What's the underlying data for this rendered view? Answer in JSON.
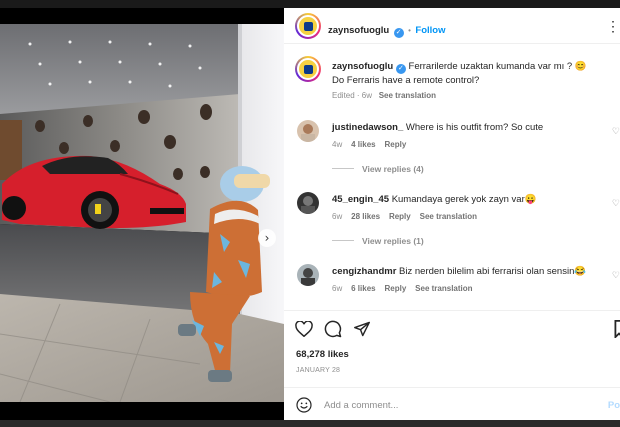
{
  "post": {
    "username": "zaynsofuoglu",
    "follow_label": "Follow",
    "separator": "•",
    "more_label": "⋮",
    "caption_line1": "Ferrarilerde uzaktan kumanda var mı ? 😊",
    "caption_line2": "Do Ferraris have a remote control?",
    "caption_meta": "Edited · 6w",
    "see_translation": "See translation",
    "likes": "68,278 likes",
    "date": "JANUARY 28",
    "add_comment_placeholder": "Add a comment...",
    "post_button": "Po",
    "next_arrow": "›"
  },
  "comments": [
    {
      "username": "justinedawson_",
      "text": "Where is his outfit from? So cute",
      "time": "4w",
      "likes": "4 likes",
      "reply": "Reply",
      "translation": "",
      "view_replies": "View replies (4)"
    },
    {
      "username": "45_engin_45",
      "text": "Kumandaya gerek yok zayn var😛",
      "time": "6w",
      "likes": "28 likes",
      "reply": "Reply",
      "translation": "See translation",
      "view_replies": "View replies (1)"
    },
    {
      "username": "cengizhandmr",
      "text": "Biz nerden bilelim abi ferrarisi olan sensin😂",
      "time": "6w",
      "likes": "6 likes",
      "reply": "Reply",
      "translation": "See translation",
      "view_replies": ""
    }
  ],
  "colors": {
    "accent": "#0095f6",
    "verified": "#3897f0",
    "car": "#d61f2c"
  }
}
